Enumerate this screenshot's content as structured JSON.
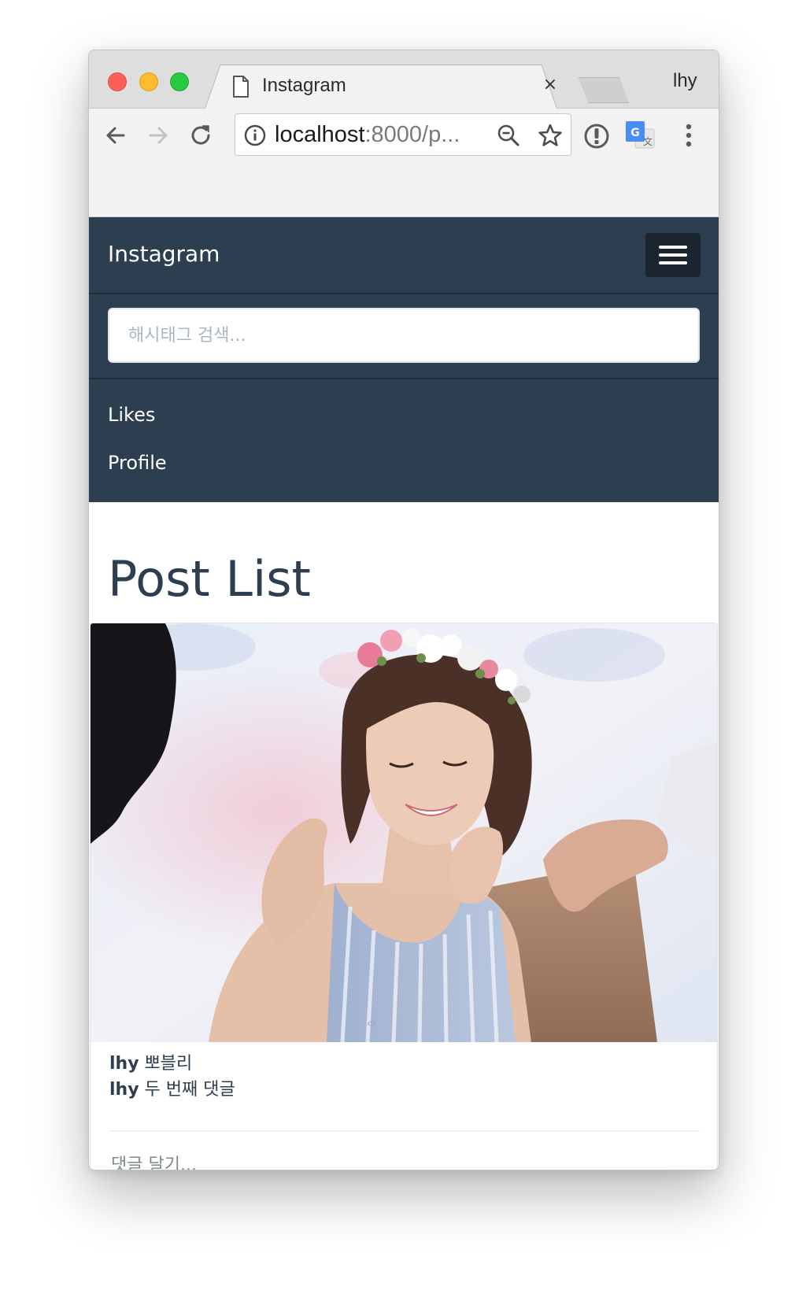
{
  "browser": {
    "tab_title": "Instagram",
    "tab_close": "×",
    "profile_name": "lhy",
    "url_host": "localhost",
    "url_rest": ":8000/p...",
    "icons": {
      "page": "page-icon",
      "close": "close-icon",
      "back": "back-arrow-icon",
      "forward": "forward-arrow-icon",
      "reload": "reload-icon",
      "info": "info-icon",
      "zoom": "zoom-out-icon",
      "bookmark": "star-icon",
      "extension": "password-manager-icon",
      "translate": "google-translate-icon",
      "menu": "kebab-menu-icon"
    }
  },
  "navbar": {
    "brand": "Instagram",
    "search_placeholder": "해시태그 검색...",
    "links": [
      {
        "label": "Likes"
      },
      {
        "label": "Profile"
      }
    ],
    "colors": {
      "background": "#2c3e50",
      "toggle": "#1a252f"
    }
  },
  "main": {
    "title": "Post List",
    "post": {
      "comments": [
        {
          "user": "lhy",
          "text": "뽀블리"
        },
        {
          "user": "lhy",
          "text": "두 번째 댓글"
        }
      ],
      "comment_placeholder": "댓글 달기..."
    }
  }
}
